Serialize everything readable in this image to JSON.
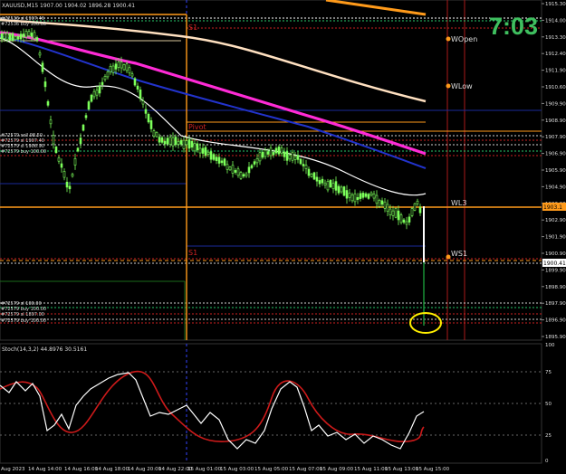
{
  "main_pane": {
    "header_text": "XAUUSD,M15  1907.00 1904.02 1896.28 1900.41",
    "clock": "7:03",
    "price_axis_labels": [
      "1915.30",
      "1914.00",
      "1913.30",
      "1912.40",
      "1911.90",
      "1910.60",
      "1909.90",
      "1908.90",
      "1907.90",
      "1906.90",
      "1905.90",
      "1904.90",
      "1903.90",
      "1902.90",
      "1901.90",
      "1900.90",
      "1899.90",
      "1898.90",
      "1897.90",
      "1896.90",
      "1895.90"
    ],
    "current_price_badge": "1900.41",
    "level_badge": "1903.1",
    "level_labels": {
      "wopen": "WOpen",
      "wlow": "WLow",
      "wl3": "WL3",
      "ws1": "WS1",
      "s1_top": "S1",
      "s1_mid": "S1",
      "pivot": "Pivot"
    },
    "left_notes": [
      "#72536 sl 1907.46",
      "#72536 buy 100.00",
      "#72579 sell 98.50",
      "#72579 sl 1907.40",
      "#72579 sl 1906.90",
      "#72579 buy 100.00",
      "#72579 sl 100.00",
      "#72579 buy 100.00",
      "#72579 sl 1897.00",
      "#72579 buy 100.00"
    ]
  },
  "sub_pane": {
    "header_text": "Stoch(14,3,2) 44.8976 30.5161",
    "axis_labels": [
      "100",
      "75",
      "50",
      "25",
      "0"
    ]
  },
  "time_axis": [
    "Aug 2023",
    "14 Aug 14:00",
    "14 Aug 16:00",
    "14 Aug 18:00",
    "14 Aug 20:00",
    "14 Aug 22:00",
    "15 Aug 01:00",
    "15 Aug 03:00",
    "15 Aug 05:00",
    "15 Aug 07:00",
    "15 Aug 09:00",
    "15 Aug 11:00",
    "15 Aug 13:00",
    "15 Aug 15:00"
  ],
  "colors": {
    "background": "#000000",
    "grid": "#1a1a1a",
    "candle": "#7cff5a",
    "ma_white": "#ffffff",
    "ma_blue": "#2233cc",
    "ma_magenta": "#ff2bd6",
    "ma_peach": "#ffe0c0",
    "level_orange": "#ff9a1a",
    "level_navy": "#1a2a9a",
    "stoch_main": "#ffffff",
    "stoch_signal": "#cc1a1a",
    "highlight": "#ffee00",
    "clock": "#3fbf5f"
  }
}
